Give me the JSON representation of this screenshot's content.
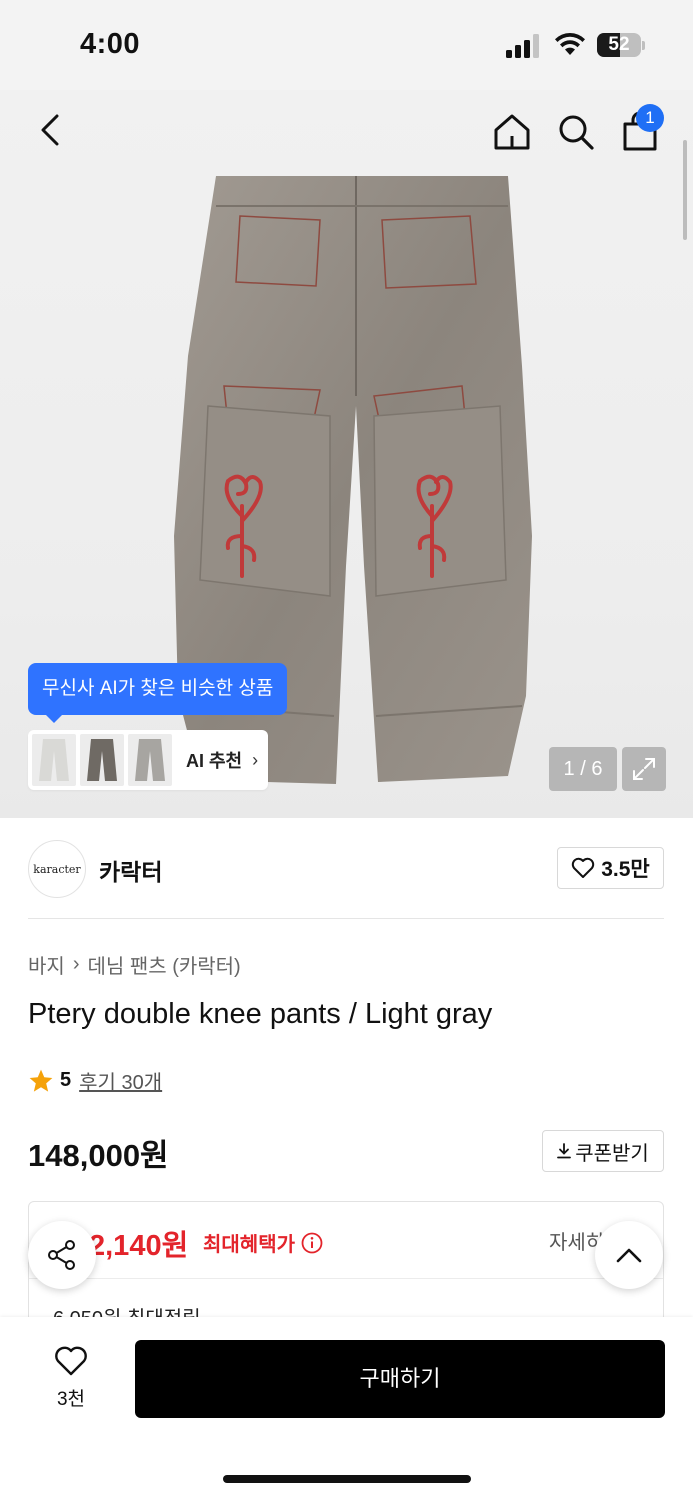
{
  "status_bar": {
    "time": "4:00",
    "battery": "52",
    "battery_level": 0.52
  },
  "header": {
    "cart_count": "1"
  },
  "gallery": {
    "ai_tooltip": "무신사 AI가 찾은 비슷한 상품",
    "ai_recommend_label": "AI 추천",
    "ai_recommend_chevron": "›",
    "counter": "1 / 6"
  },
  "brand": {
    "logo_text": "karacter",
    "name": "카락터",
    "likes": "3.5만"
  },
  "breadcrumb": {
    "category": "바지",
    "separator": "›",
    "subcategory": "데님 팬츠 (카락터)"
  },
  "product": {
    "title": "Ptery double knee pants / Light gray",
    "rating": "5",
    "reviews": "후기 30개",
    "price": "148,000원",
    "coupon_label": "쿠폰받기"
  },
  "benefit": {
    "max_price": "2,140원",
    "max_label": "최대혜택가",
    "detail": "자세히",
    "points": "6,050원 최대적립"
  },
  "bottom": {
    "wish_count": "3천",
    "buy_label": "구매하기"
  },
  "colors": {
    "accent_blue": "#2f73ff",
    "sale_red": "#e3242b",
    "buy_black": "#000000"
  },
  "icons": [
    "back-icon",
    "home-icon",
    "search-icon",
    "cart-icon",
    "expand-icon",
    "heart-icon",
    "star-icon",
    "download-icon",
    "info-icon",
    "share-icon",
    "chevron-up-icon"
  ]
}
